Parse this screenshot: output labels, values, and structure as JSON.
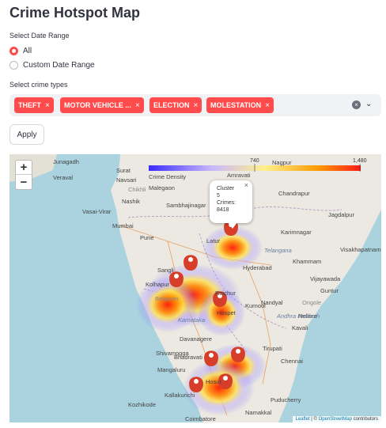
{
  "page": {
    "title": "Crime Hotspot Map"
  },
  "date_range": {
    "label": "Select Date Range",
    "options": [
      {
        "label": "All",
        "selected": true
      },
      {
        "label": "Custom Date Range",
        "selected": false
      }
    ]
  },
  "crime_types": {
    "label": "Select crime types",
    "chips": [
      {
        "label": "THEFT",
        "close": "×"
      },
      {
        "label": "MOTOR VEHICLE ...",
        "close": "×"
      },
      {
        "label": "ELECTION",
        "close": "×"
      },
      {
        "label": "MOLESTATION",
        "close": "×"
      }
    ],
    "clear_icon": "×",
    "chevron_icon": "⌄"
  },
  "apply_button": {
    "label": "Apply"
  },
  "map": {
    "zoom_in": "+",
    "zoom_out": "−",
    "legend": {
      "label_mid": "740",
      "label_max": "1,480"
    },
    "popup": {
      "line1": "Cluster",
      "line2": "5",
      "line3": "Crimes:",
      "line4": "8418",
      "close": "×"
    },
    "attribution": {
      "leaflet": "Leaflet",
      "separator": " | © ",
      "osm": "OpenStreetMap",
      "suffix": " contributors"
    },
    "cities": [
      "Junagadh",
      "Surat",
      "Navsari",
      "Nagpur",
      "Veraval",
      "Chikhli",
      "Amravati",
      "Crime Density",
      "Malegaon",
      "Chandrapur",
      "Nashik",
      "Sambhajinagar",
      "Vasai-Virar",
      "Jagdalpur",
      "Mumbai",
      "Karimnagar",
      "Pune",
      "Latur",
      "Telangana",
      "Visakhapatnam",
      "Hyderabad",
      "Khammam",
      "Sangli",
      "Kolhapur",
      "Vijayawada",
      "Raichur",
      "Guntur",
      "Kurnool",
      "Karnataka",
      "Hospet",
      "Nellore",
      "Tirupati",
      "Kavali",
      "Davanagere",
      "Shivamogga",
      "Bhadravati",
      "Mangaluru",
      "Chennai",
      "Kallakurichi",
      "Puducherry",
      "Namakkal",
      "Coimbatore",
      "Ongole",
      "Belgaum",
      "Andhra Pradesh",
      "Hosur",
      "Nandyal",
      "Kozhikode"
    ]
  },
  "colors": {
    "accent": "#ff4b4b",
    "marker": "#d63e2a"
  }
}
